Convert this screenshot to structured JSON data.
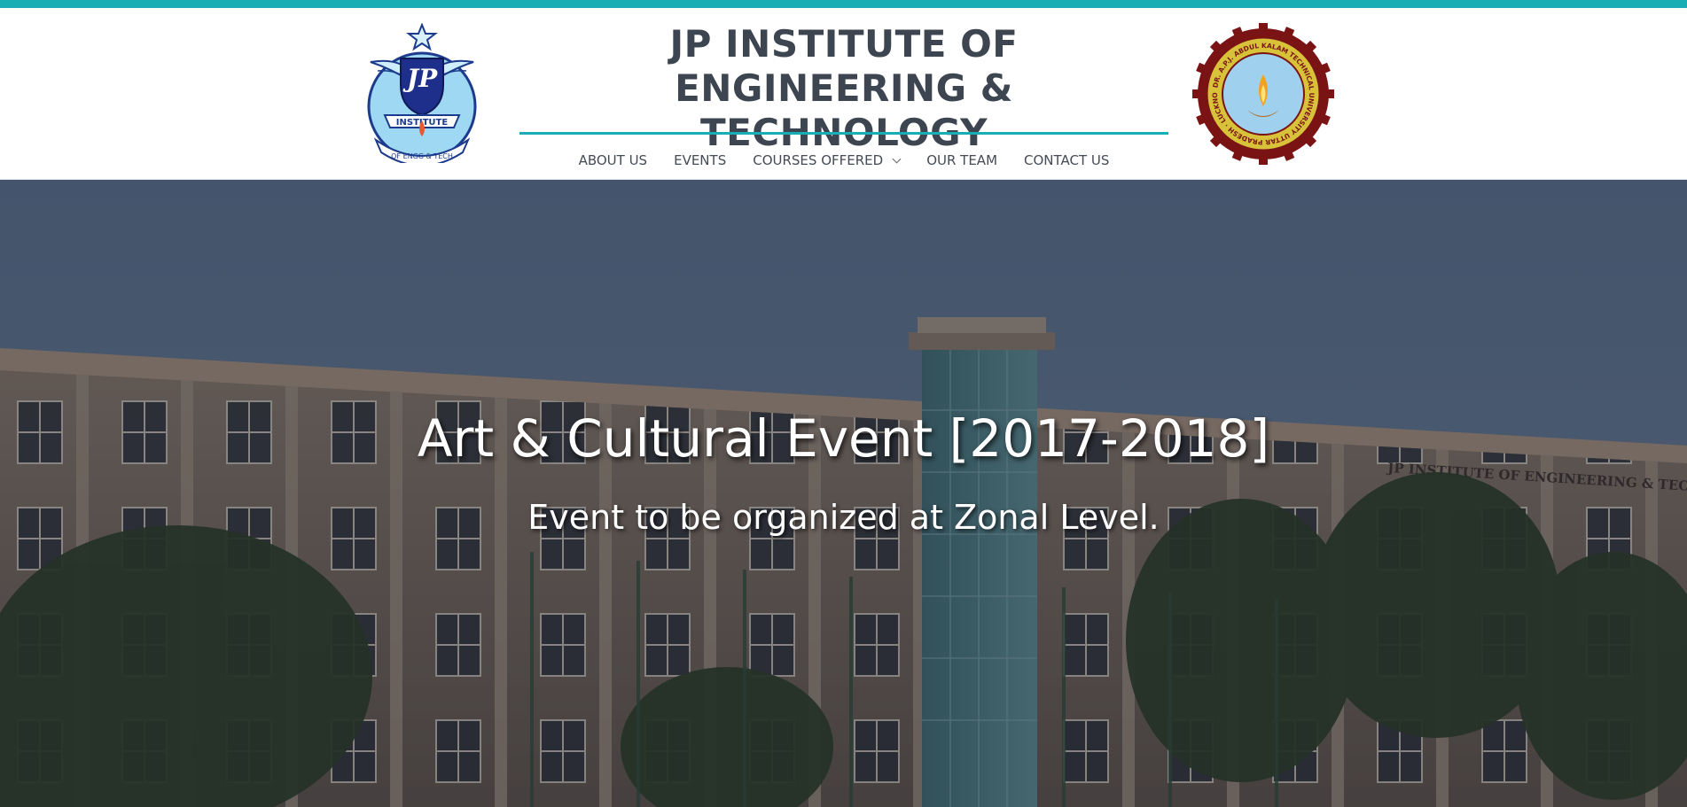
{
  "header": {
    "title_line1": "JP INSTITUTE OF ENGINEERING &",
    "title_line2": "TECHNOLOGY",
    "logo_left_icon": "jp-institute-crest-icon",
    "logo_left_text": "INSTITUTE OF ENGG & TECH",
    "logo_right_icon": "aktu-university-seal-icon",
    "logo_right_text": "DR. A.P.J. ABDUL KALAM TECHNICAL UNIVERSITY UTTAR PRADESH LUCKNOW"
  },
  "nav": {
    "items": [
      {
        "label": "ABOUT US"
      },
      {
        "label": "EVENTS"
      },
      {
        "label": "COURSES OFFERED",
        "has_dropdown": true
      },
      {
        "label": "OUR TEAM"
      },
      {
        "label": "CONTACT US"
      }
    ]
  },
  "hero": {
    "title": "Art & Cultural Event [2017-2018]",
    "subtitle": "Event to be organized at Zonal Level.",
    "building_sign": "JP INSTITUTE OF ENGINEERING & TECHNOLOGY"
  },
  "colors": {
    "accent": "#19adb4",
    "title_text": "#3c4550",
    "nav_text": "#444b55"
  }
}
